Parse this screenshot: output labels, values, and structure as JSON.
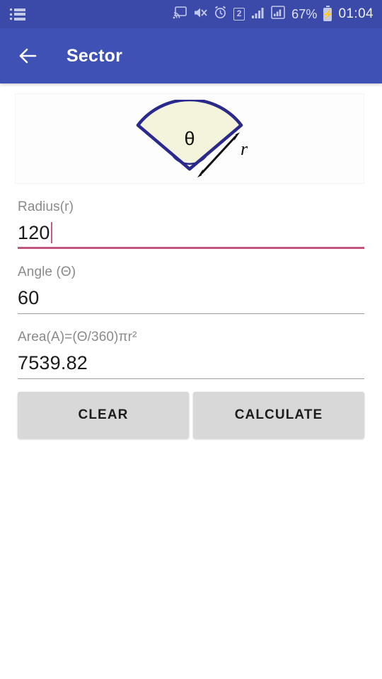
{
  "status_bar": {
    "left_icon": "list-icon",
    "icons": [
      "cast-icon",
      "mute-icon",
      "alarm-icon",
      "sim2-icon",
      "signal-1-icon",
      "signal-2-icon"
    ],
    "sim_badge": "2",
    "battery_percent": "67%",
    "battery_state": "charging",
    "time": "01:04",
    "background_color": "#3b4aa8"
  },
  "app_bar": {
    "back_icon": "back-arrow-icon",
    "title": "Sector",
    "background_color": "#3f51b5"
  },
  "diagram": {
    "name": "sector-diagram",
    "angle_label": "θ",
    "radius_label": "r",
    "stroke_color": "#2a2a8c",
    "fill_color": "#f5f5dc"
  },
  "fields": [
    {
      "name": "radius",
      "label": "Radius(r)",
      "value": "120",
      "placeholder": "",
      "focused": true,
      "underline_color": "#c2547e"
    },
    {
      "name": "angle",
      "label": "Angle (Θ)",
      "value": "60",
      "placeholder": "",
      "focused": false,
      "underline_color": "#9e9e9e"
    },
    {
      "name": "area",
      "label": "Area(A)=(Θ/360)πr²",
      "value": "7539.82",
      "placeholder": "",
      "focused": false,
      "underline_color": "#9e9e9e"
    }
  ],
  "buttons": {
    "clear_label": "CLEAR",
    "calculate_label": "CALCULATE",
    "background_color": "#d8d8d8"
  }
}
